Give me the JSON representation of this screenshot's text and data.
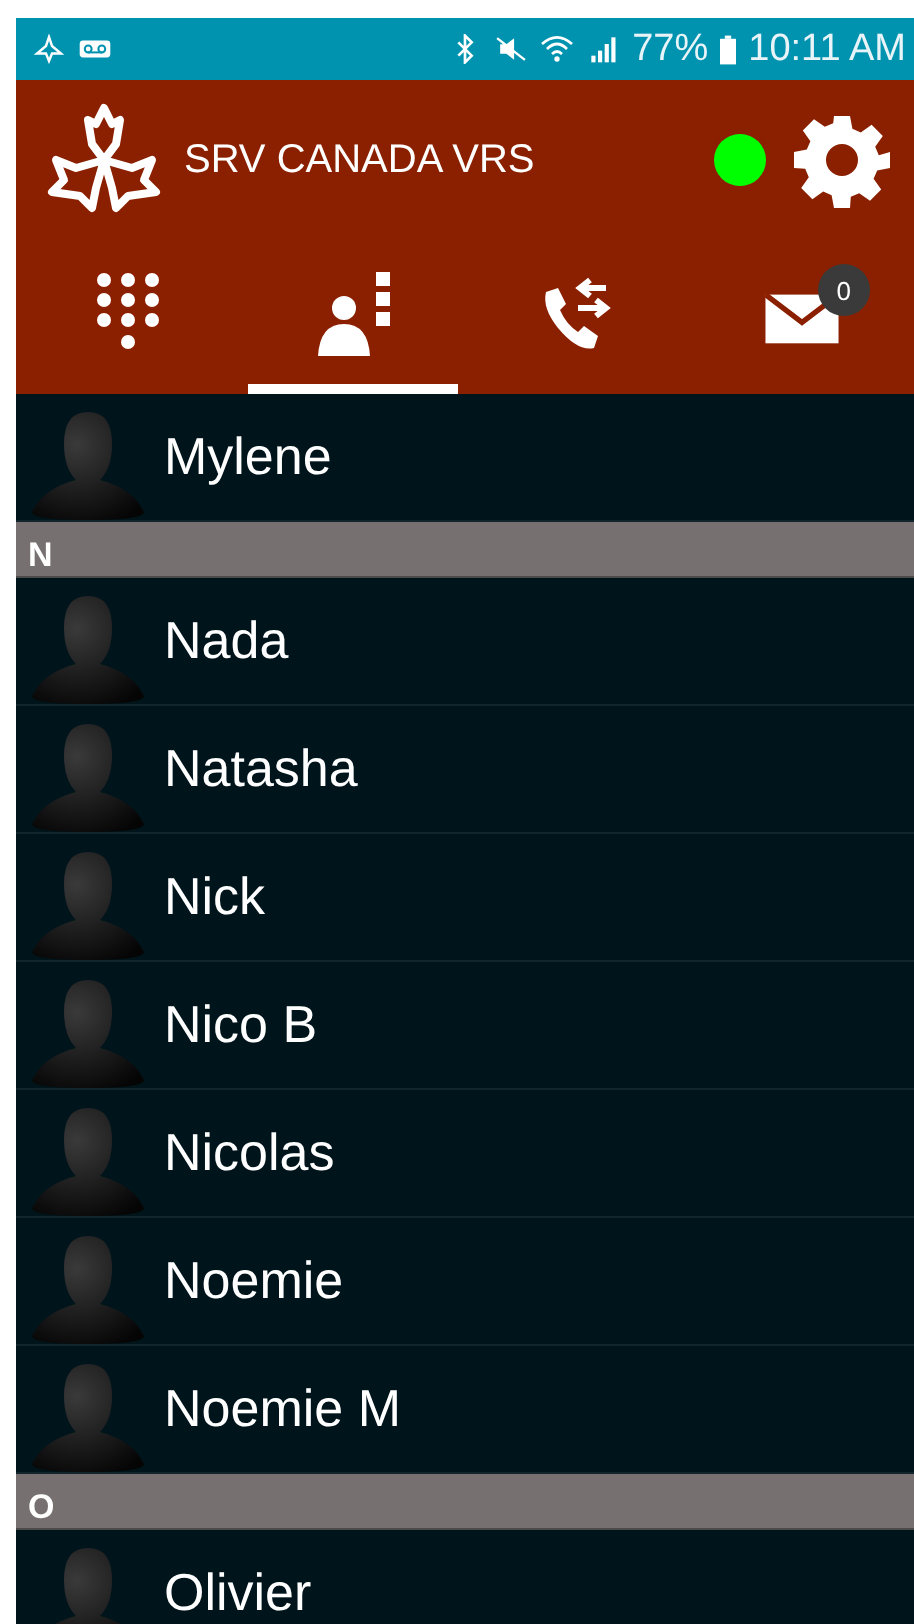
{
  "status_bar": {
    "battery": "77%",
    "time": "10:11 AM"
  },
  "header": {
    "title": "SRV CANADA VRS",
    "online": true
  },
  "tabs": [
    {
      "kind": "dialpad",
      "selected": false
    },
    {
      "kind": "contacts",
      "selected": true
    },
    {
      "kind": "calls",
      "selected": false
    },
    {
      "kind": "messages",
      "selected": false,
      "badge": "0"
    }
  ],
  "list": [
    {
      "kind": "contact",
      "name": "Mylene"
    },
    {
      "kind": "section",
      "label": "N"
    },
    {
      "kind": "contact",
      "name": "Nada"
    },
    {
      "kind": "contact",
      "name": "Natasha"
    },
    {
      "kind": "contact",
      "name": "Nick"
    },
    {
      "kind": "contact",
      "name": "Nico B"
    },
    {
      "kind": "contact",
      "name": "Nicolas"
    },
    {
      "kind": "contact",
      "name": "Noemie"
    },
    {
      "kind": "contact",
      "name": "Noemie M"
    },
    {
      "kind": "section",
      "label": "O"
    },
    {
      "kind": "contact",
      "name": "Olivier"
    }
  ]
}
